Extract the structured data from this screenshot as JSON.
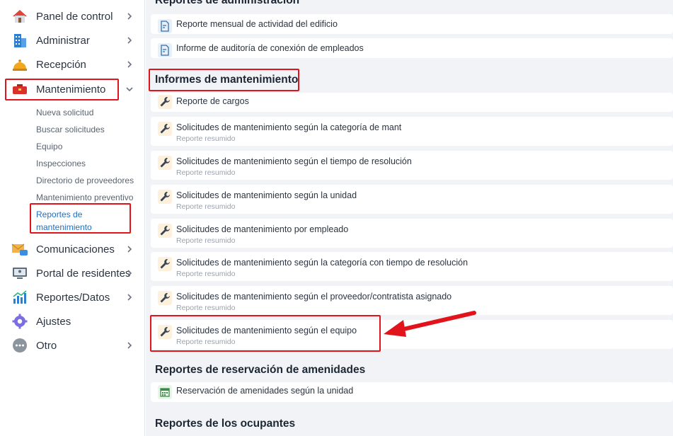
{
  "sidebar": {
    "nav": [
      {
        "label": "Panel de control",
        "icon": "house-icon"
      },
      {
        "label": "Administrar",
        "icon": "building-icon"
      },
      {
        "label": "Recepción",
        "icon": "service-bell-icon"
      },
      {
        "label": "Mantenimiento",
        "icon": "toolbox-icon"
      },
      {
        "label": "Comunicaciones",
        "icon": "envelope-chat-icon"
      },
      {
        "label": "Portal de residentes",
        "icon": "monitor-user-icon"
      },
      {
        "label": "Reportes/Datos",
        "icon": "bar-chart-icon"
      },
      {
        "label": "Ajustes",
        "icon": "gear-icon"
      },
      {
        "label": "Otro",
        "icon": "more-dots-icon"
      }
    ],
    "maintenance_sub": [
      "Nueva solicitud",
      "Buscar solicitudes",
      "Equipo",
      "Inspecciones",
      "Directorio de proveedores",
      "Mantenimiento preventivo",
      "Reportes de mantenimiento"
    ]
  },
  "main": {
    "admin_section_title": "Reportes de administración",
    "admin_reports": [
      "Reporte mensual de actividad del edificio",
      "Informe de auditoría de conexión de empleados"
    ],
    "maintenance_section_title": "Informes de mantenimiento",
    "maintenance_reports": [
      {
        "title": "Reporte de cargos",
        "sub": ""
      },
      {
        "title": "Solicitudes de mantenimiento según la categoría de mant",
        "sub": "Reporte resumido"
      },
      {
        "title": "Solicitudes de mantenimiento según el tiempo de resolución",
        "sub": "Reporte resumido"
      },
      {
        "title": "Solicitudes de mantenimiento según la unidad",
        "sub": "Reporte resumido"
      },
      {
        "title": "Solicitudes de mantenimiento por empleado",
        "sub": "Reporte resumido"
      },
      {
        "title": "Solicitudes de mantenimiento según la categoría con tiempo de resolución",
        "sub": "Reporte resumido"
      },
      {
        "title": "Solicitudes de mantenimiento según el proveedor/contratista asignado",
        "sub": "Reporte resumido"
      },
      {
        "title": "Solicitudes de mantenimiento según el equipo",
        "sub": "Reporte resumido"
      }
    ],
    "amenity_section_title": "Reportes de reservación de amenidades",
    "amenity_reports": [
      "Reservación de amenidades según la unidad"
    ],
    "occupants_section_title": "Reportes de los ocupantes"
  },
  "colors": {
    "highlight": "#e2141b",
    "active_link": "#1f6fbf",
    "main_bg": "#f1f3f6"
  }
}
